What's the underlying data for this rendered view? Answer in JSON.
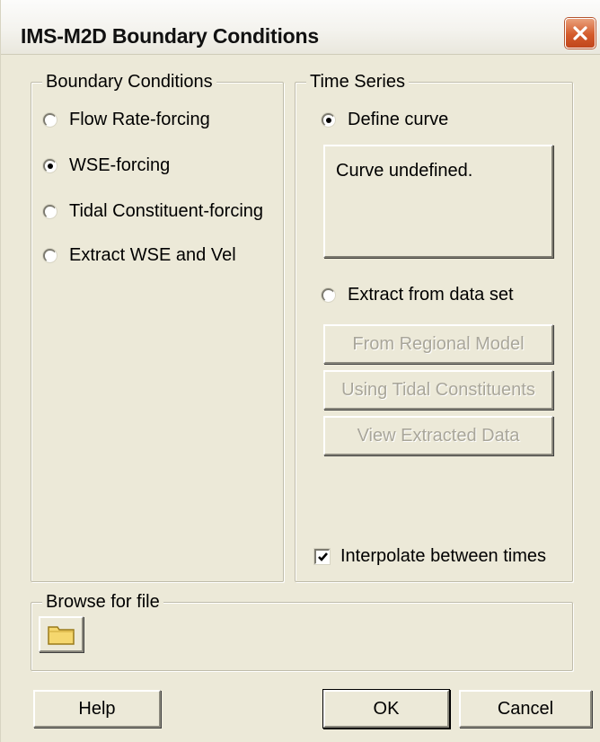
{
  "window": {
    "title": "IMS-M2D Boundary Conditions",
    "close_icon": "close-icon"
  },
  "boundary_conditions": {
    "title": "Boundary Conditions",
    "options": [
      {
        "label": "Flow Rate-forcing",
        "checked": false
      },
      {
        "label": "WSE-forcing",
        "checked": true
      },
      {
        "label": "Tidal Constituent-forcing",
        "checked": false
      },
      {
        "label": "Extract WSE and Vel",
        "checked": false
      }
    ]
  },
  "time_series": {
    "title": "Time Series",
    "define_curve_label": "Define curve",
    "define_curve_checked": true,
    "curve_status": "Curve undefined.",
    "extract_label": "Extract from data set",
    "extract_checked": false,
    "from_regional_model_label": "From Regional Model",
    "using_tidal_constituents_label": "Using Tidal Constituents",
    "view_extracted_data_label": "View Extracted Data",
    "interpolate_label": "Interpolate between times",
    "interpolate_checked": true
  },
  "browse": {
    "title": "Browse for file",
    "icon": "folder-icon"
  },
  "footer": {
    "help_label": "Help",
    "ok_label": "OK",
    "cancel_label": "Cancel"
  }
}
